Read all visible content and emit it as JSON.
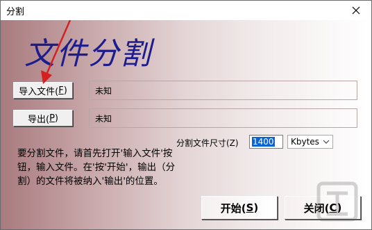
{
  "window": {
    "title": "分割",
    "close_glyph": "✕"
  },
  "header": {
    "big_title": "文件分割"
  },
  "import": {
    "button_label": "导入文件(",
    "button_key": "F",
    "button_suffix": ")",
    "value": "未知"
  },
  "export": {
    "button_label": "导出(",
    "button_key": "P",
    "button_suffix": ")",
    "value": "未知"
  },
  "split_size": {
    "label": "分割文件尺寸(Z)",
    "value": "1400",
    "unit_selected": "Kbytes"
  },
  "description": "要分割文件，请首先打开'输入文件'按钮，输入文件。在'按'开始'，输出（分割）的文件将被纳入'输出'的位置。",
  "actions": {
    "start_label": "开始(",
    "start_key": "S",
    "start_suffix": ")",
    "close_label": "关闭(",
    "close_key": "C",
    "close_suffix": ")"
  },
  "colors": {
    "title_blue": "#1c1c8c",
    "annotation_arrow": "#d42020",
    "selection_blue": "#0a64d6"
  },
  "icons": {
    "close": "close-icon",
    "chevron": "chevron-down-icon"
  }
}
